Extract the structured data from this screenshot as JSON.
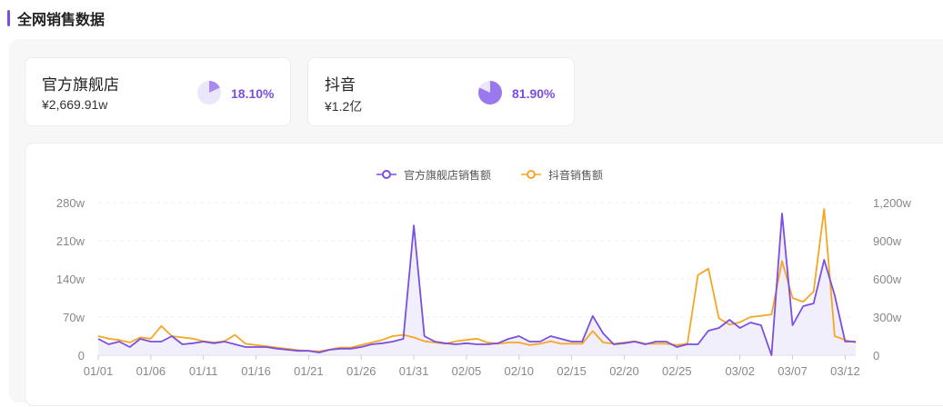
{
  "section": {
    "title": "全网销售数据"
  },
  "cards": [
    {
      "name": "官方旗舰店",
      "value": "¥2,669.91w",
      "percent": "18.10%",
      "share": 0.181
    },
    {
      "name": "抖音",
      "value": "¥1.2亿",
      "percent": "81.90%",
      "share": 0.819
    }
  ],
  "colors": {
    "primary": "#7b4fe0",
    "secondary": "#f5a623",
    "pie_bg": "#ebe7fb"
  },
  "chart_data": {
    "type": "line",
    "legend_position": "top-center",
    "grid": true,
    "x_tick_labels": [
      "01/01",
      "01/06",
      "01/11",
      "01/16",
      "01/21",
      "01/26",
      "01/31",
      "02/05",
      "02/10",
      "02/15",
      "02/20",
      "02/25",
      "03/02",
      "03/07",
      "03/12"
    ],
    "x_tick_indices": [
      0,
      5,
      10,
      15,
      20,
      25,
      30,
      35,
      40,
      45,
      50,
      55,
      61,
      66,
      71
    ],
    "n_points": 73,
    "y_left": {
      "ticks": [
        "0",
        "70w",
        "140w",
        "210w",
        "280w"
      ],
      "range": [
        0,
        280
      ]
    },
    "y_right": {
      "ticks": [
        "0",
        "300w",
        "600w",
        "900w",
        "1,200w"
      ],
      "range": [
        0,
        1200
      ]
    },
    "series": [
      {
        "name": "官方旗舰店销售额",
        "axis": "left",
        "values": [
          30,
          20,
          25,
          15,
          30,
          25,
          25,
          35,
          20,
          22,
          25,
          22,
          25,
          20,
          15,
          15,
          15,
          12,
          10,
          8,
          8,
          5,
          10,
          12,
          12,
          15,
          20,
          22,
          25,
          30,
          238,
          35,
          25,
          22,
          20,
          22,
          20,
          20,
          22,
          30,
          35,
          25,
          25,
          35,
          30,
          25,
          25,
          72,
          40,
          20,
          22,
          25,
          20,
          25,
          25,
          15,
          20,
          20,
          45,
          50,
          65,
          50,
          60,
          55,
          0,
          260,
          55,
          90,
          95,
          175,
          110,
          25,
          25
        ]
      },
      {
        "name": "抖音销售额",
        "axis": "right",
        "values": [
          150,
          130,
          120,
          100,
          140,
          130,
          230,
          150,
          140,
          130,
          110,
          100,
          110,
          160,
          90,
          80,
          70,
          60,
          50,
          40,
          35,
          30,
          45,
          60,
          60,
          80,
          100,
          120,
          150,
          160,
          140,
          110,
          100,
          90,
          110,
          120,
          130,
          100,
          90,
          100,
          100,
          80,
          90,
          110,
          90,
          90,
          90,
          190,
          100,
          90,
          100,
          110,
          90,
          90,
          90,
          80,
          90,
          630,
          680,
          290,
          240,
          260,
          300,
          310,
          320,
          740,
          450,
          420,
          500,
          1150,
          150,
          120,
          100
        ]
      }
    ]
  }
}
